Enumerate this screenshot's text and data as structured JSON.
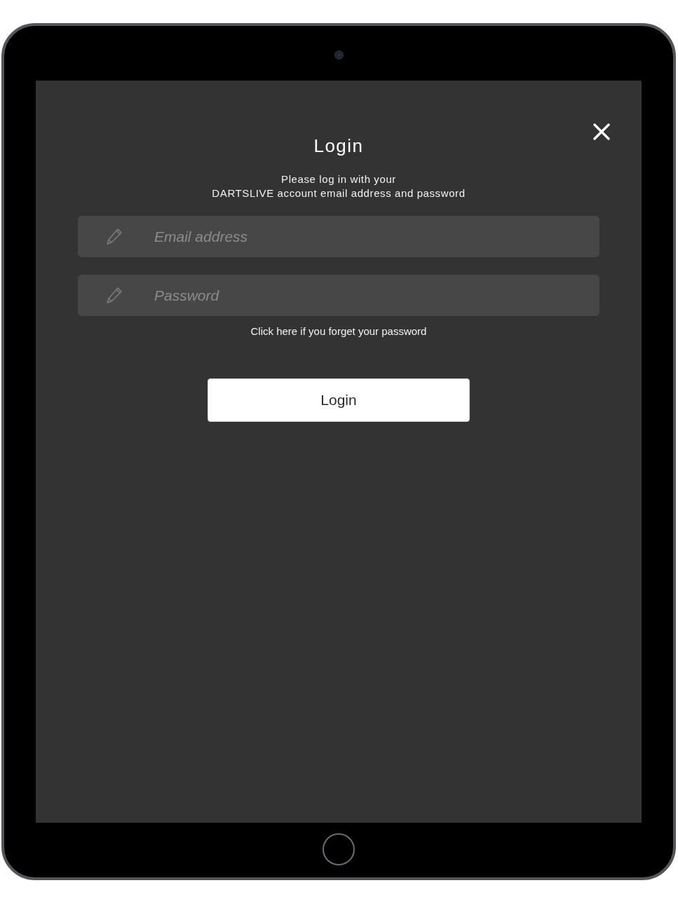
{
  "dialog": {
    "title": "Login",
    "instructions": "Please log in with your\nDARTSLIVE account email address and password"
  },
  "email_field": {
    "placeholder": "Email address"
  },
  "password_field": {
    "placeholder": "Password"
  },
  "forgot_link": "Click here if you forget your password",
  "login_button": "Login"
}
